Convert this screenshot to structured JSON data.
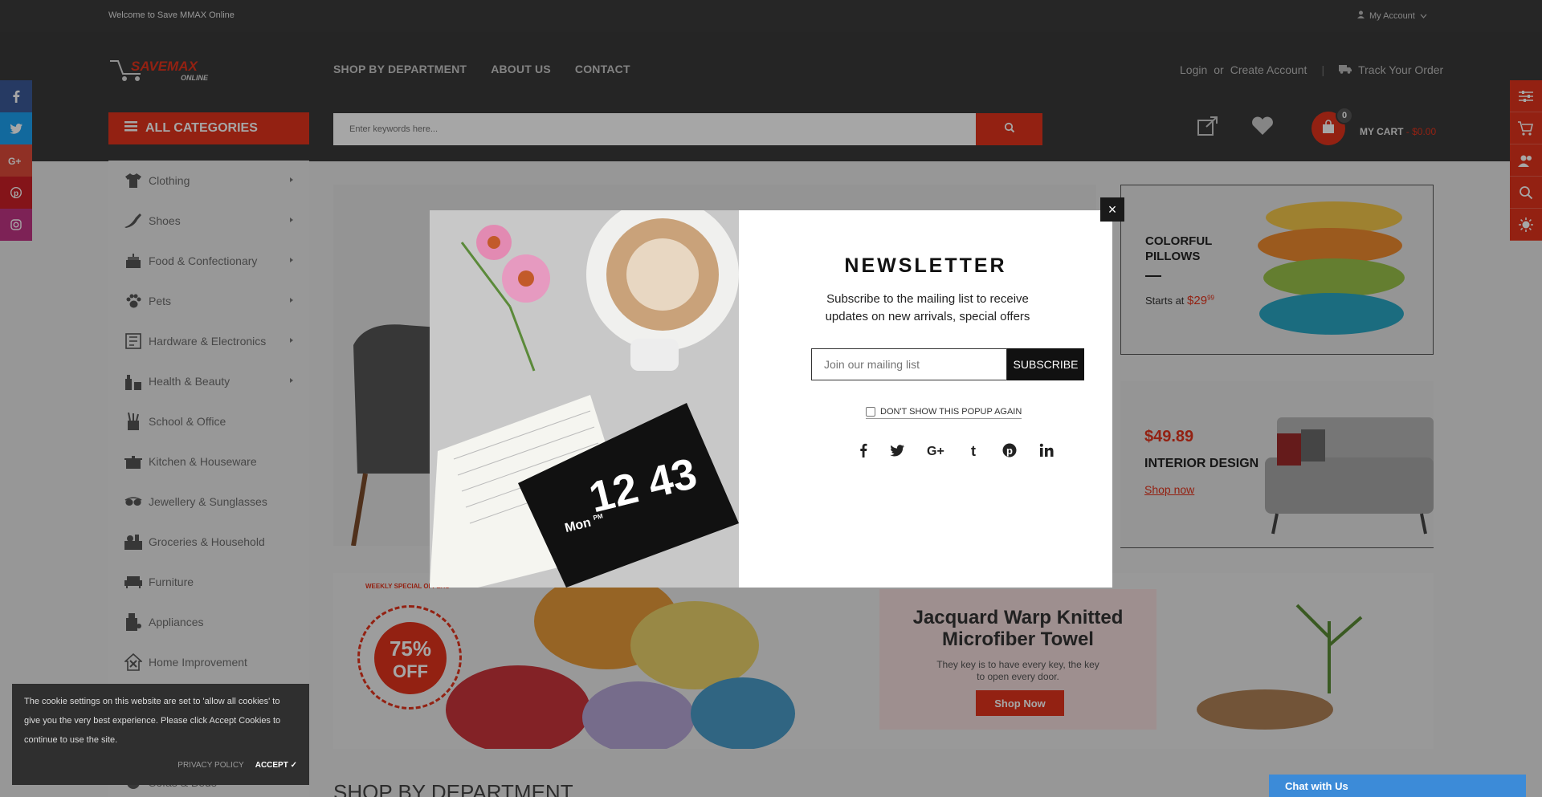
{
  "topbar": {
    "welcome": "Welcome to Save MMAX Online",
    "account_label": "My Account"
  },
  "header": {
    "logo_text": "SAVEMAX",
    "logo_sub": "ONLINE",
    "nav": [
      "SHOP BY DEPARTMENT",
      "ABOUT US",
      "CONTACT"
    ],
    "login": "Login",
    "or": "or",
    "create_account": "Create Account",
    "track_order": "Track Your Order",
    "all_categories": "ALL CATEGORIES",
    "search_placeholder": "Enter keywords here...",
    "cart_count": "0",
    "cart_label": "MY CART",
    "cart_amount": "- $0.00"
  },
  "categories": [
    "Clothing",
    "Shoes",
    "Food & Confectionary",
    "Pets",
    "Hardware & Electronics",
    "Health & Beauty",
    "School & Office",
    "Kitchen & Houseware",
    "Jewellery & Sunglasses",
    "Groceries & Household",
    "Furniture",
    "Appliances",
    "Home Improvement",
    "",
    "",
    "Sofas & Beds"
  ],
  "banners": {
    "pillows_title_1": "COLORFUL",
    "pillows_title_2": "PILLOWS",
    "pillows_starts": "Starts at",
    "pillows_price": "$29",
    "pillows_cents": "99",
    "sofa_price": "$49.89",
    "sofa_title": "INTERIOR DESIGN",
    "sofa_link": "Shop now",
    "towel_title_1": "Jacquard Warp Knitted",
    "towel_title_2": "Microfiber Towel",
    "towel_desc_1": "They key is to have every key, the key",
    "towel_desc_2": "to open every door.",
    "towel_button": "Shop Now",
    "badge_pct": "75%",
    "badge_off": "OFF",
    "badge_ring": "WEEKLY SPECIAL OFFERS"
  },
  "shop_by_department": "SHOP BY DEPARTMENT",
  "newsletter": {
    "title": "NEWSLETTER",
    "subtitle": "Subscribe to the mailing list to receive updates on new arrivals, special offers",
    "placeholder": "Join our mailing list",
    "subscribe": "SUBSCRIBE",
    "dont_show": "DON'T SHOW THIS POPUP AGAIN",
    "close": "×",
    "clock_time": "12 43",
    "clock_day": "Mon",
    "clock_pm": "PM"
  },
  "cookie": {
    "text": "The cookie settings on this website are set to 'allow all cookies' to give you the very best experience. Please click Accept Cookies to continue to use the site.",
    "privacy": "PRIVACY POLICY",
    "accept": "ACCEPT ✓"
  },
  "chat": "Chat with Us",
  "colors": {
    "accent": "#e2341d",
    "header_bg": "#3a3a3a",
    "facebook": "#3b5998",
    "twitter": "#1da1f2",
    "google": "#dd4b39",
    "pinterest": "#cb2027",
    "instagram": "#c13584"
  }
}
